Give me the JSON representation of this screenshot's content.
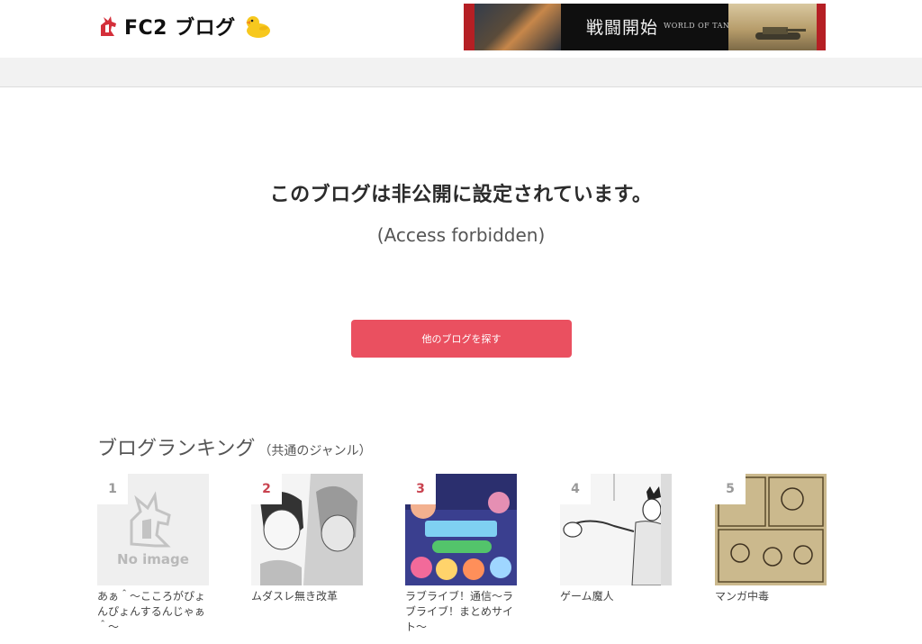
{
  "header": {
    "logo_text": "FC2 ブログ",
    "banner": {
      "title": "戦闘開始",
      "subtitle": "WORLD OF TANKS"
    }
  },
  "message": {
    "main": "このブログは非公開に設定されています。",
    "sub": "(Access forbidden)"
  },
  "button": {
    "label": "他のブログを探す"
  },
  "colors": {
    "button": "#ea5060",
    "rank_number": "#c9434f"
  },
  "ranking": {
    "title": "ブログランキング",
    "subtitle": "（共通のジャンル）",
    "items": [
      {
        "rank": "1",
        "caption": "あぁ＾〜こころがぴょんぴょんするんじゃぁ＾〜",
        "thumb_text": "No image"
      },
      {
        "rank": "2",
        "caption": "ムダスレ無き改革"
      },
      {
        "rank": "3",
        "caption": "ラブライブ！通信〜ラブライブ！まとめサイト〜"
      },
      {
        "rank": "4",
        "caption": "ゲーム魔人"
      },
      {
        "rank": "5",
        "caption": "マンガ中毒"
      }
    ]
  }
}
